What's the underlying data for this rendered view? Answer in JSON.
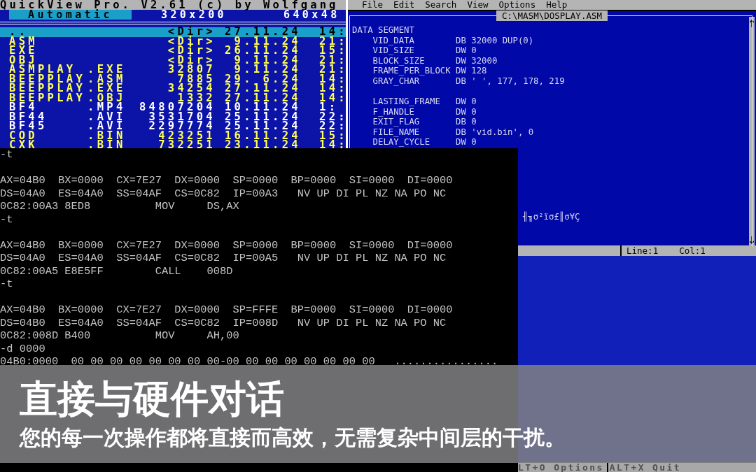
{
  "file_viewer": {
    "title": "QuickView Pro. V2.61 (c) by Wolfgang",
    "modes": [
      {
        "label": "Automatic",
        "selected": true
      },
      {
        "label": "320x200",
        "selected": false
      },
      {
        "label": "640x48",
        "selected": false
      }
    ],
    "files": [
      {
        "name": "..",
        "size": "<Dir>",
        "date": "27.11.24",
        "time": "14:",
        "selected": true
      },
      {
        "name": "ASM",
        "size": "<Dir>",
        "date": "9.11.24",
        "time": "21:",
        "selected": false,
        "color": "#ffff55"
      },
      {
        "name": "EXE",
        "size": "<Dir>",
        "date": "26.11.24",
        "time": "15:",
        "selected": false,
        "color": "#ffff55"
      },
      {
        "name": "OBJ",
        "size": "<Dir>",
        "date": "9.11.24",
        "time": "21:",
        "selected": false,
        "color": "#ffff55"
      },
      {
        "name": "ASMPLAY",
        "ext": ".EXE",
        "size": "32807",
        "date": "9.11.24",
        "time": "21:",
        "selected": false,
        "color": "#ffff55"
      },
      {
        "name": "BEEPPLAY",
        "ext": ".ASM",
        "size": "7885",
        "date": "29. 6.24",
        "time": "14:",
        "selected": false,
        "color": "#ffff55"
      },
      {
        "name": "BEEPPLAY",
        "ext": ".EXE",
        "size": "34254",
        "date": "27.11.24",
        "time": "14:",
        "selected": false,
        "color": "#ffff55"
      },
      {
        "name": "BEEPPLAY",
        "ext": ".OBJ",
        "size": "1332",
        "date": "27.11.24",
        "time": "14:",
        "selected": false,
        "color": "#ffff55"
      },
      {
        "name": "BF4",
        "ext": ".MP4",
        "size": "84807204",
        "date": "10.11.24",
        "time": "1:",
        "selected": false,
        "color": "#ffffff"
      },
      {
        "name": "BF44",
        "ext": ".AVI",
        "size": "3531704",
        "date": "25.11.24",
        "time": "22:",
        "selected": false,
        "color": "#ffffff"
      },
      {
        "name": "BF45",
        "ext": ".AVI",
        "size": "2297774",
        "date": "25.11.24",
        "time": "22:",
        "selected": false,
        "color": "#ffffff"
      },
      {
        "name": "COD",
        "ext": ".BIN",
        "size": "423251",
        "date": "16.11.24",
        "time": "15:",
        "selected": false,
        "color": "#ffff55"
      },
      {
        "name": "CXK",
        "ext": ".BIN",
        "size": "732251",
        "date": "23.11.24",
        "time": "14:",
        "selected": false,
        "color": "#ffff55"
      }
    ]
  },
  "editor": {
    "menu": [
      "File",
      "Edit",
      "Search",
      "View",
      "Options",
      "Help"
    ],
    "title": "C:\\MASM\\DOSPLAY.ASM",
    "code_blocks": [
      [
        "DATA SEGMENT",
        "    VID_DATA        DB 32000 DUP(0)",
        "    VID_SIZE        DW 0",
        "    BLOCK_SIZE      DW 32000",
        "    FRAME_PER_BLOCK DW 128",
        "    GRAY_CHAR       DB ' ', 177, 178, 219"
      ],
      [
        "    LASTING_FRAME   DW 0",
        "    F_HANDLE        DW 0",
        "    EXIT_FLAG       DB 0",
        "    FILE_NAME       DB 'vid.bin', 0",
        "    DELAY_CYCLE     DW 0"
      ]
    ],
    "garbled_line": "╢╖σ²ïσ£║σ¥Ç",
    "status": {
      "line": "Line:1",
      "column": "Col:1"
    }
  },
  "lower_window": {
    "hints": [
      "LT+O Options",
      "ALT+X Quit"
    ]
  },
  "debugger": {
    "blocks": [
      [
        "-t"
      ],
      [
        "AX=04B0  BX=0000  CX=7E27  DX=0000  SP=0000  BP=0000  SI=0000  DI=0000",
        "DS=04A0  ES=04A0  SS=04AF  CS=0C82  IP=00A3   NV UP DI PL NZ NA PO NC",
        "0C82:00A3 8ED8          MOV     DS,AX",
        "-t"
      ],
      [
        "AX=04B0  BX=0000  CX=7E27  DX=0000  SP=0000  BP=0000  SI=0000  DI=0000",
        "DS=04A0  ES=04A0  SS=04AF  CS=0C82  IP=00A5   NV UP DI PL NZ NA PO NC",
        "0C82:00A5 E8E5FF        CALL    008D",
        "-t"
      ],
      [
        "AX=04B0  BX=0000  CX=7E27  DX=0000  SP=FFFE  BP=0000  SI=0000  DI=0000",
        "DS=04B0  ES=04A0  SS=04AF  CS=0C82  IP=008D   NV UP DI PL NZ NA PO NC",
        "0C82:008D B400          MOV     AH,00",
        "-d 0000",
        "04B0:0000  00 00 00 00 00 00 00 00-00 00 00 00 00 00 00 00   ................"
      ]
    ]
  },
  "caption": {
    "title": "直接与硬件对话",
    "subtitle": "您的每一次操作都将直接而高效，无需复杂中间层的干扰。"
  }
}
